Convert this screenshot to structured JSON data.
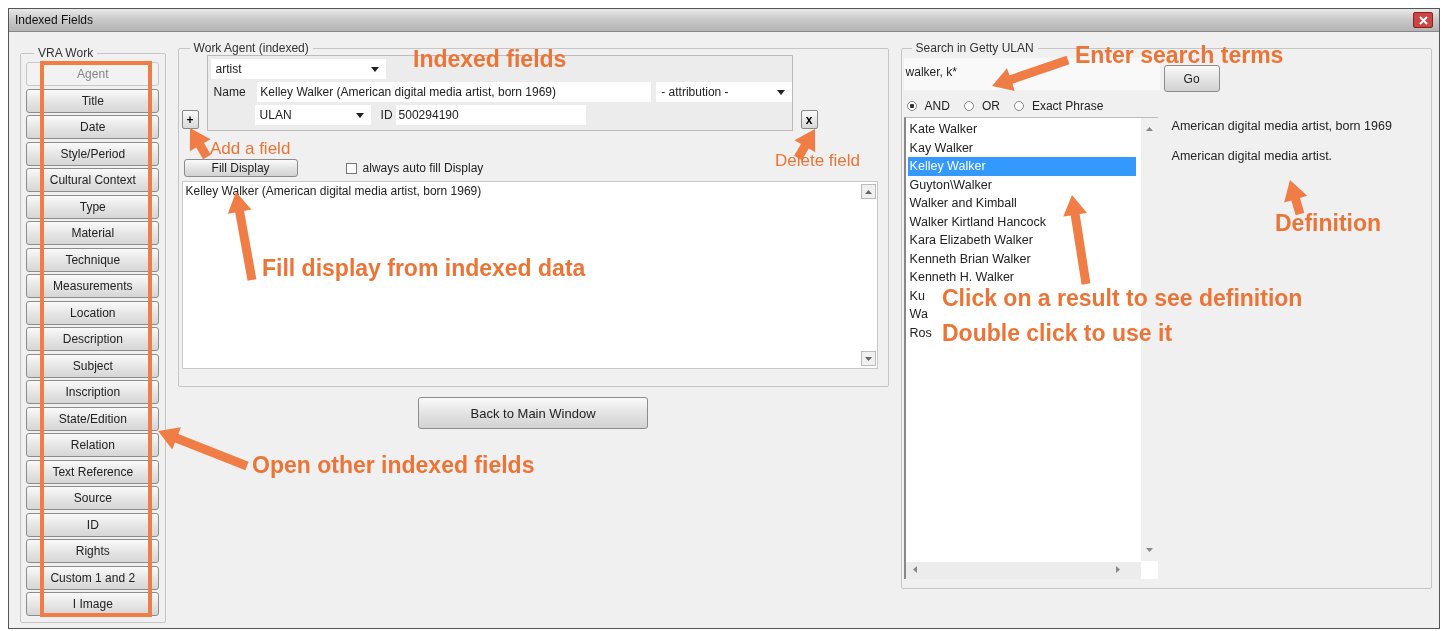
{
  "window": {
    "title": "Indexed Fields"
  },
  "vra_work": {
    "label": "VRA Work",
    "buttons": [
      {
        "label": "Agent",
        "disabled": true
      },
      {
        "label": "Title",
        "disabled": false
      },
      {
        "label": "Date",
        "disabled": false
      },
      {
        "label": "Style/Period",
        "disabled": false
      },
      {
        "label": "Cultural Context",
        "disabled": false
      },
      {
        "label": "Type",
        "disabled": false
      },
      {
        "label": "Material",
        "disabled": false
      },
      {
        "label": "Technique",
        "disabled": false
      },
      {
        "label": "Measurements",
        "disabled": false
      },
      {
        "label": "Location",
        "disabled": false
      },
      {
        "label": "Description",
        "disabled": false
      },
      {
        "label": "Subject",
        "disabled": false
      },
      {
        "label": "Inscription",
        "disabled": false
      },
      {
        "label": "State/Edition",
        "disabled": false
      },
      {
        "label": "Relation",
        "disabled": false
      },
      {
        "label": "Text Reference",
        "disabled": false
      },
      {
        "label": "Source",
        "disabled": false
      },
      {
        "label": "ID",
        "disabled": false
      },
      {
        "label": "Rights",
        "disabled": false
      },
      {
        "label": "Custom 1 and 2",
        "disabled": false
      },
      {
        "label": "I Image",
        "disabled": false
      }
    ]
  },
  "work_agent": {
    "label": "Work Agent (indexed)",
    "role": "artist",
    "name_label": "Name",
    "name": "Kelley Walker (American digital media artist, born 1969)",
    "attribution": "- attribution -",
    "vocabulary": "ULAN",
    "id_label": "ID",
    "id": "500294190",
    "add_button": "+",
    "delete_button": "x",
    "fill_display_button": "Fill Display",
    "auto_fill": {
      "label": "always auto fill Display",
      "checked": false
    },
    "display": "Kelley Walker (American digital media artist, born 1969)"
  },
  "back_button": "Back to Main Window",
  "search": {
    "label": "Search in Getty ULAN",
    "query": "walker, k*",
    "go_button": "Go",
    "modes": [
      {
        "label": "AND",
        "selected": true
      },
      {
        "label": "OR",
        "selected": false
      },
      {
        "label": "Exact Phrase",
        "selected": false
      }
    ],
    "results": [
      {
        "label": "Kate Walker",
        "selected": false
      },
      {
        "label": "Kay Walker",
        "selected": false
      },
      {
        "label": "Kelley Walker",
        "selected": true
      },
      {
        "label": "Guyton\\Walker",
        "selected": false
      },
      {
        "label": "Walker and Kimball",
        "selected": false
      },
      {
        "label": "Walker Kirtland Hancock",
        "selected": false
      },
      {
        "label": "Kara Elizabeth Walker",
        "selected": false
      },
      {
        "label": "Kenneth Brian Walker",
        "selected": false
      },
      {
        "label": "Kenneth H. Walker",
        "selected": false
      },
      {
        "label": "Ku",
        "selected": false
      },
      {
        "label": "Wa",
        "selected": false
      },
      {
        "label": "Ros",
        "selected": false
      }
    ],
    "definitions": [
      "American digital media artist, born 1969",
      "American digital media artist."
    ]
  },
  "annotations": [
    {
      "text": "Indexed fields",
      "kind": "large"
    },
    {
      "text": "Enter search terms",
      "kind": "large"
    },
    {
      "text": "Add a field",
      "kind": "small"
    },
    {
      "text": "Delete field",
      "kind": "small"
    },
    {
      "text": "Fill display from indexed data",
      "kind": "large"
    },
    {
      "text": "Definition",
      "kind": "large"
    },
    {
      "text": "Click on a result to see definition",
      "kind": "large"
    },
    {
      "text": "Double click to use it",
      "kind": "large"
    },
    {
      "text": "Open other indexed fields",
      "kind": "large"
    }
  ]
}
